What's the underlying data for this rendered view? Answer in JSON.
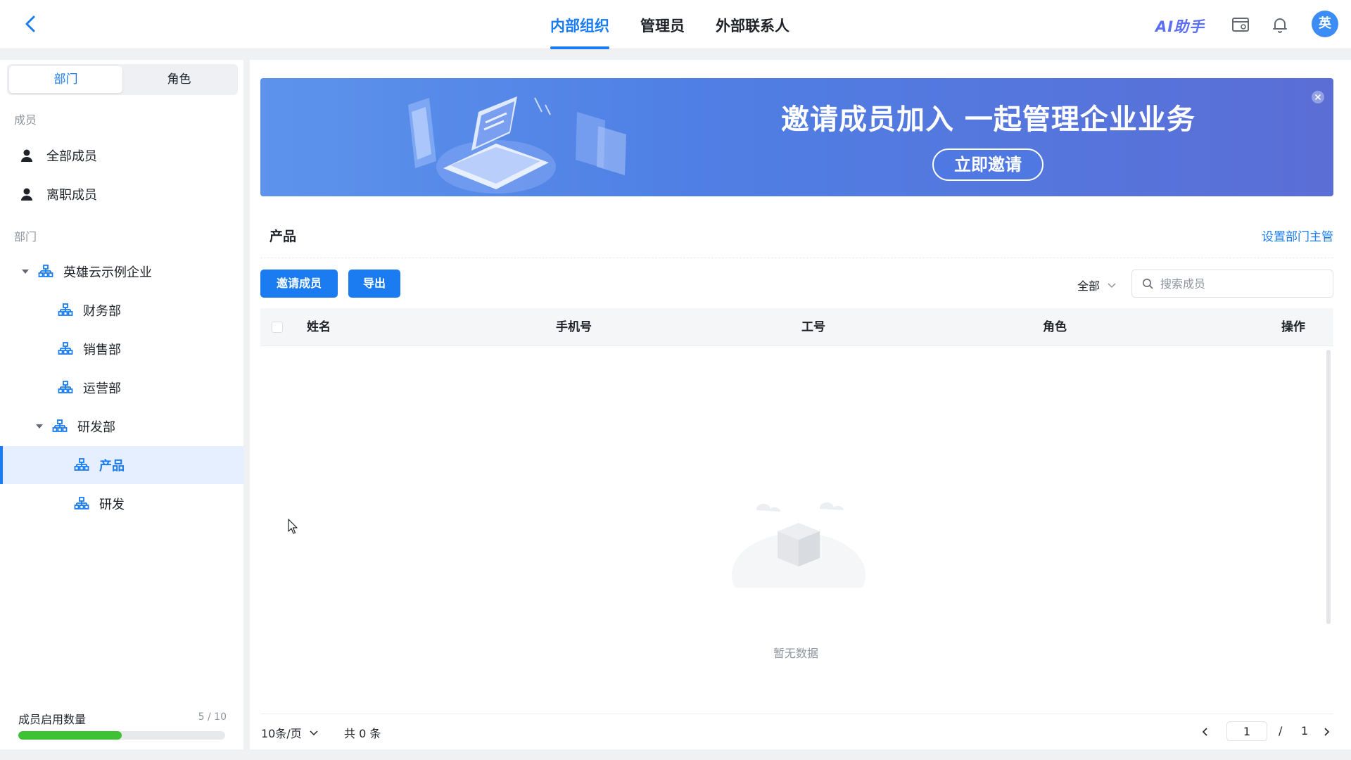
{
  "top_tabs": [
    {
      "label": "内部组织",
      "active": true
    },
    {
      "label": "管理员",
      "active": false
    },
    {
      "label": "外部联系人",
      "active": false
    }
  ],
  "ai_assistant": "AI助手",
  "avatar_initial": "英",
  "sidebar": {
    "segments": [
      "部门",
      "角色"
    ],
    "members_section": "成员",
    "member_items": [
      "全部成员",
      "离职成员"
    ],
    "dept_section": "部门",
    "tree": [
      {
        "label": "英雄云示例企业",
        "level": 0,
        "expanded": true
      },
      {
        "label": "财务部",
        "level": 1
      },
      {
        "label": "销售部",
        "level": 1
      },
      {
        "label": "运营部",
        "level": 1
      },
      {
        "label": "研发部",
        "level": 1,
        "expanded": true
      },
      {
        "label": "产品",
        "level": 2,
        "selected": true
      },
      {
        "label": "研发",
        "level": 2
      }
    ],
    "quota": {
      "label": "成员启用数量",
      "count": "5 / 10",
      "fraction": 0.5
    }
  },
  "banner": {
    "title": "邀请成员加入 一起管理企业业务",
    "button": "立即邀请"
  },
  "main": {
    "dept_title": "产品",
    "set_head": "设置部门主管",
    "invite_button": "邀请成员",
    "export_button": "导出",
    "filter": "全部",
    "search_placeholder": "搜索成员",
    "columns": [
      "姓名",
      "手机号",
      "工号",
      "角色",
      "操作"
    ],
    "empty_text": "暂无数据"
  },
  "pagination": {
    "page_size": "10条/页",
    "total": "共 0 条",
    "current_page": "1",
    "separator": "/",
    "total_pages": "1"
  },
  "colors": {
    "accent": "#1a7cf0",
    "progress": "#3cc233"
  }
}
